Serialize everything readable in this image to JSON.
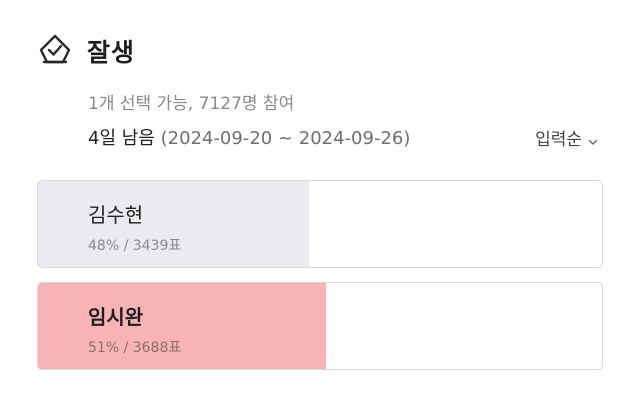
{
  "poll": {
    "title": "잘생",
    "meta": "1개 선택 가능, 7127명 참여",
    "deadline": "4일 남음",
    "date_range": "(2024-09-20 ~ 2024-09-26)",
    "sort_label": "입력순"
  },
  "options": [
    {
      "name": "김수현",
      "stat": "48% / 3439표",
      "percent": 48,
      "votes": 3439,
      "fill_color": "#e9ebee",
      "selected": false
    },
    {
      "name": "임시완",
      "stat": "51% / 3688표",
      "percent": 51,
      "votes": 3688,
      "fill_color": "#f8b4b5",
      "selected": true
    }
  ],
  "icons": {
    "poll": "poll-check-icon",
    "sort": "chevron-down-icon"
  },
  "colors": {
    "highlight": "#f8b4b5",
    "neutral_fill": "#e9ebee",
    "border": "#d7d7d7"
  }
}
